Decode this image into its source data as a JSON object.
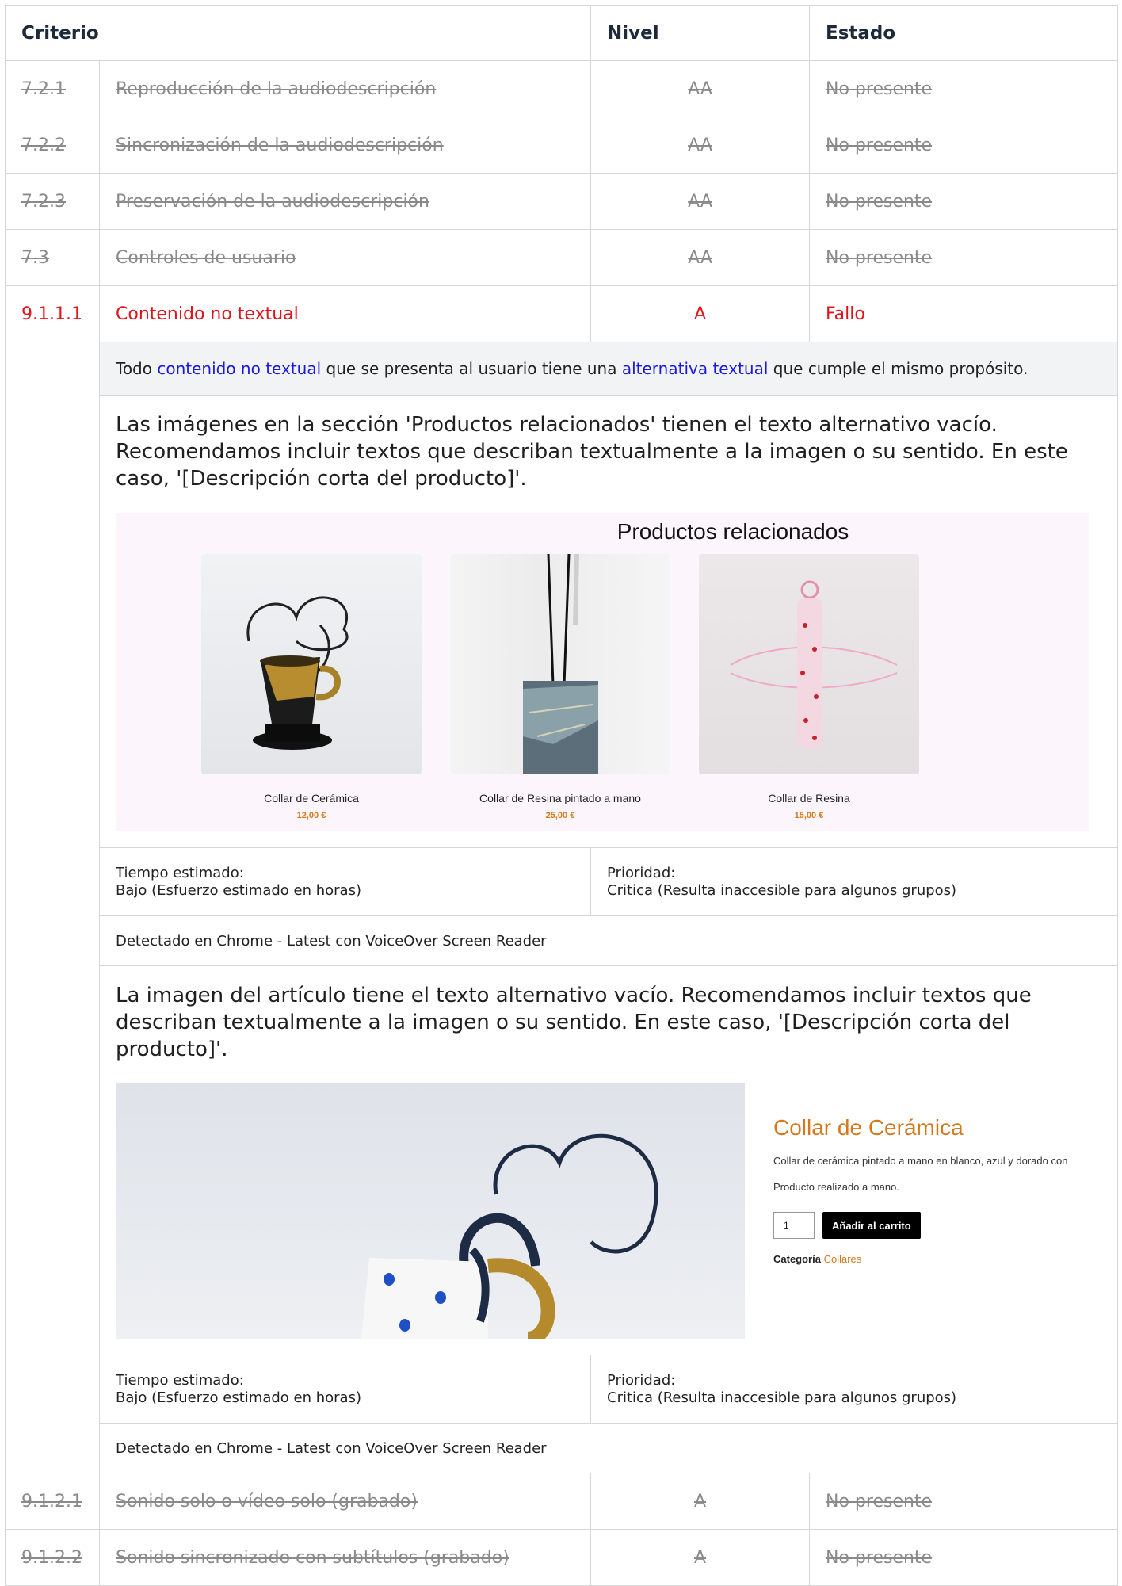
{
  "headers": {
    "criterio": "Criterio",
    "nivel": "Nivel",
    "estado": "Estado"
  },
  "rows_top": [
    {
      "id": "7.2.1",
      "name": "Reproducción de la audiodescripción",
      "level": "AA",
      "status": "No presente"
    },
    {
      "id": "7.2.2",
      "name": "Sincronización de la audiodescripción",
      "level": "AA",
      "status": "No presente"
    },
    {
      "id": "7.2.3",
      "name": "Preservación de la audiodescripción",
      "level": "AA",
      "status": "No presente"
    },
    {
      "id": "7.3",
      "name": "Controles de usuario",
      "level": "AA",
      "status": "No presente"
    }
  ],
  "fail_row": {
    "id": "9.1.1.1",
    "name": "Contenido no textual",
    "level": "A",
    "status": "Fallo"
  },
  "description": {
    "p1": "Todo ",
    "link1": "contenido no textual",
    "p2": " que se presenta al usuario tiene una ",
    "link2": "alternativa textual",
    "p3": " que cumple el mismo propósito."
  },
  "issue1": {
    "text": "Las imágenes en la sección 'Productos relacionados' tienen el texto alternativo vacío. Recomendamos incluir textos que describan textualmente a la imagen o su sentido. En este caso, '[Descripción corta del producto]'.",
    "screenshot": {
      "title": "Productos relacionados",
      "products": [
        {
          "name": "Collar de Cerámica",
          "price": "12,00 €"
        },
        {
          "name": "Collar de Resina pintado a mano",
          "price": "25,00 €"
        },
        {
          "name": "Collar de Resina",
          "price": "15,00 €"
        }
      ]
    },
    "time_label": "Tiempo estimado:",
    "time_value": "Bajo (Esfuerzo estimado en horas)",
    "priority_label": "Prioridad:",
    "priority_value": "Critica (Resulta inaccesible para algunos grupos)",
    "detected": "Detectado en Chrome - Latest con VoiceOver Screen Reader"
  },
  "issue2": {
    "text": "La imagen del artículo tiene el texto alternativo vacío. Recomendamos incluir textos que describan textualmente a la imagen o su sentido. En este caso, '[Descripción corta del producto]'.",
    "screenshot": {
      "title": "Collar de Cerámica",
      "description": "Collar de cerámica pintado a mano en blanco, azul y dorado con",
      "made": "Producto realizado a mano.",
      "qty": "1",
      "add_button": "Añadir al carrito",
      "category_label": "Categoría",
      "category_value": "Collares"
    },
    "time_label": "Tiempo estimado:",
    "time_value": "Bajo (Esfuerzo estimado en horas)",
    "priority_label": "Prioridad:",
    "priority_value": "Critica (Resulta inaccesible para algunos grupos)",
    "detected": "Detectado en Chrome - Latest con VoiceOver Screen Reader"
  },
  "rows_bottom": [
    {
      "id": "9.1.2.1",
      "name": "Sonido solo o vídeo solo (grabado)",
      "level": "A",
      "status": "No presente"
    },
    {
      "id": "9.1.2.2",
      "name": "Sonido sincronizado con subtítulos (grabado)",
      "level": "A",
      "status": "No presente"
    }
  ],
  "colors": {
    "fail": "#e0141b",
    "link": "#1a1adc",
    "accent": "#d4781c",
    "muted": "#8a8a8a"
  }
}
